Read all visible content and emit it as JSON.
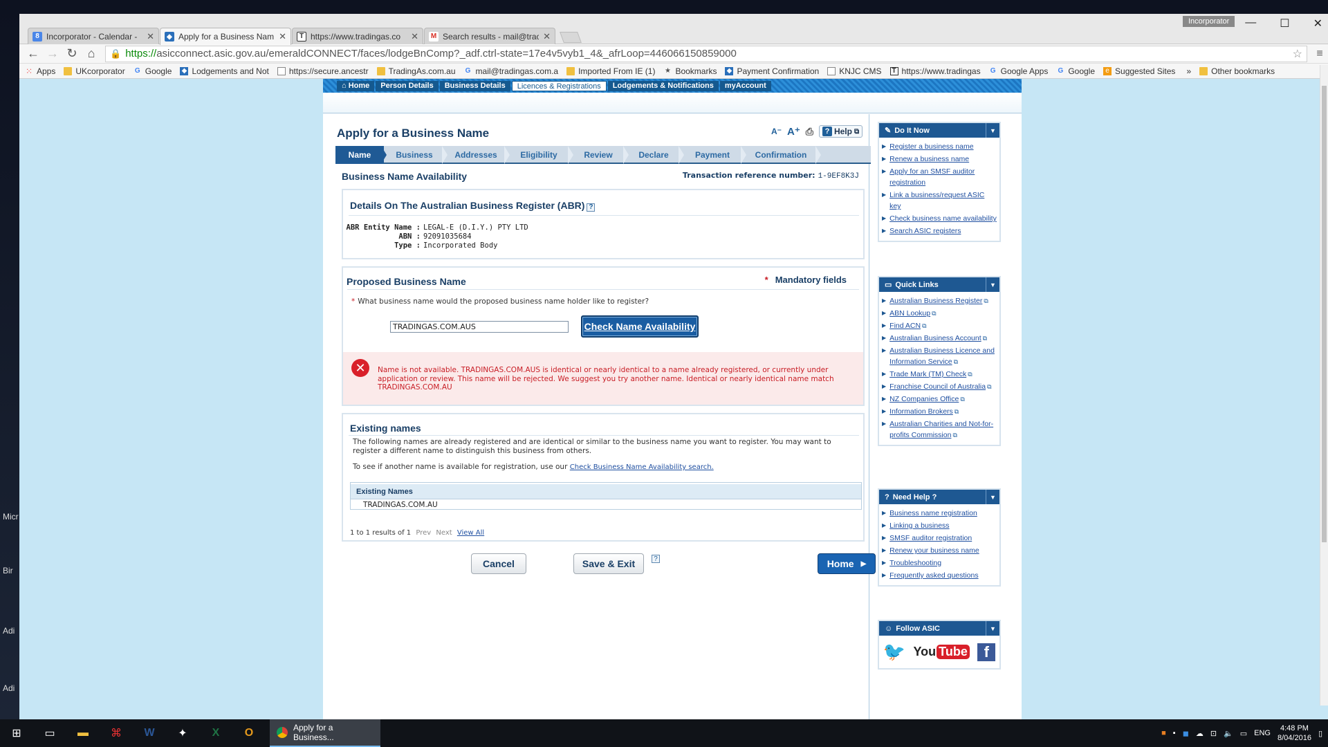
{
  "desktop": {
    "side_labels": [
      "Micr",
      "Bir",
      "Adi",
      "Adi"
    ]
  },
  "browser": {
    "tabs": [
      {
        "title": "Incorporator - Calendar -",
        "favicon_color": "#4a86e8",
        "favicon_char": "8"
      },
      {
        "title": "Apply for a Business Nam",
        "favicon_color": "#2a6fba",
        "favicon_char": "◆"
      },
      {
        "title": "https://www.tradingas.co",
        "favicon_color": "#333333",
        "favicon_char": "T"
      },
      {
        "title": "Search results - mail@trac",
        "favicon_color": "#d93025",
        "favicon_char": "M"
      }
    ],
    "profile_label": "Incorporator",
    "url_https": "https://",
    "url_rest": "asicconnect.asic.gov.au/emeraldCONNECT/faces/lodgeBnComp?_adf.ctrl-state=17e4v5vyb1_4&_afrLoop=446066150859000",
    "bookmarks": [
      {
        "label": "Apps",
        "icon": "grid"
      },
      {
        "label": "UKcorporator",
        "icon": "folder"
      },
      {
        "label": "Google",
        "icon": "G"
      },
      {
        "label": "Lodgements and Not",
        "icon": "asic"
      },
      {
        "label": "https://secure.ancestr",
        "icon": "page"
      },
      {
        "label": "TradingAs.com.au",
        "icon": "folder"
      },
      {
        "label": "mail@tradingas.com.a",
        "icon": "G"
      },
      {
        "label": "Imported From IE (1)",
        "icon": "folder"
      },
      {
        "label": "Bookmarks",
        "icon": "star"
      },
      {
        "label": "Payment Confirmation",
        "icon": "asic"
      },
      {
        "label": "KNJC CMS",
        "icon": "page"
      },
      {
        "label": "https://www.tradingas",
        "icon": "T"
      },
      {
        "label": "Google Apps",
        "icon": "G"
      },
      {
        "label": "Google",
        "icon": "G"
      },
      {
        "label": "Suggested Sites",
        "icon": "ie"
      }
    ],
    "more_bookmarks": "»",
    "other_bookmarks": "Other bookmarks"
  },
  "site": {
    "topnav": [
      "Home",
      "Person Details",
      "Business Details",
      "Licences & Registrations",
      "Lodgements & Notifications",
      "myAccount"
    ],
    "topnav_active_index": 3,
    "page_title": "Apply for a Business Name",
    "help_label": "Help",
    "steps": [
      "Name",
      "Business",
      "Addresses",
      "Eligibility",
      "Review",
      "Declare",
      "Payment",
      "Confirmation"
    ],
    "active_step": "Name",
    "section_heading": "Business Name Availability",
    "txn_label": "Transaction reference number:",
    "txn_value": "1-9EF8K3J",
    "abr": {
      "title": "Details On The Australian Business Register (ABR)",
      "entity_label": "ABR Entity Name :",
      "entity_value": "LEGAL-E (D.I.Y.) PTY LTD",
      "abn_label": "ABN :",
      "abn_value": "92091035684",
      "type_label": "Type :",
      "type_value": "Incorporated Body"
    },
    "proposed": {
      "title": "Proposed Business Name",
      "mandatory_star": "*",
      "mandatory_label": "Mandatory fields",
      "question": "What business name would the proposed business name holder like to register?",
      "input_value": "TRADINGAS.COM.AUS",
      "check_button": "Check Name Availability",
      "error_message": "Name is not available. TRADINGAS.COM.AUS is identical or nearly identical to a name already registered, or currently under application or review. This name will be rejected. We suggest you try another name. Identical or nearly identical name match TRADINGAS.COM.AU"
    },
    "existing": {
      "title": "Existing names",
      "description": "The following names are already registered and are identical or similar to the business name you want to register. You may want to register a different name to distinguish this business from others.",
      "check_prefix": "To see if another name is available for registration, use our",
      "check_link": "Check Business Name Availability search.",
      "table_header": "Existing Names",
      "rows": [
        "TRADINGAS.COM.AU"
      ],
      "pagination": "1 to 1 results of 1",
      "prev": "Prev",
      "next": "Next",
      "view_all": "View All"
    },
    "buttons": {
      "cancel": "Cancel",
      "save_exit": "Save & Exit",
      "home": "Home"
    },
    "sidebar": {
      "do_it_now": {
        "title": "Do It Now",
        "items": [
          "Register a business name",
          "Renew a business name",
          "Apply for an SMSF auditor registration",
          "Link a business/request ASIC key",
          "Check business name availability",
          "Search ASIC registers"
        ]
      },
      "quick_links": {
        "title": "Quick Links",
        "items": [
          "Australian Business Register",
          "ABN Lookup",
          "Find ACN",
          "Australian Business Account",
          "Australian Business Licence and Information Service",
          "Trade Mark (TM) Check",
          "Franchise Council of Australia",
          "NZ Companies Office",
          "Information Brokers",
          "Australian Charities and Not-for-profits Commission"
        ]
      },
      "need_help": {
        "title": "Need Help ?",
        "items": [
          "Business name registration",
          "Linking a business",
          "SMSF auditor registration",
          "Renew your business name",
          "Troubleshooting",
          "Frequently asked questions"
        ]
      },
      "follow": {
        "title": "Follow ASIC",
        "youtube": "YouTube"
      }
    }
  },
  "taskbar": {
    "active_app": "Apply for a Business...",
    "lang": "ENG",
    "time": "4:48 PM",
    "date": "8/04/2016"
  }
}
